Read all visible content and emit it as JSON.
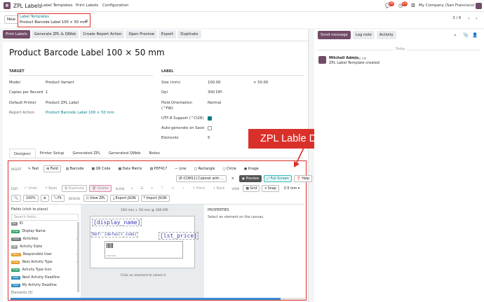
{
  "app": {
    "name": "ZPL Labels",
    "menu": [
      "Label Templates",
      "Print Labels",
      "Configuration"
    ],
    "msg_count": "26",
    "activity_count": "25",
    "company": "My Company (San Francisco)"
  },
  "breadcrumb": {
    "new": "New",
    "parent": "Label Templates",
    "current": "Product Barcode Label 100 × 50 mm"
  },
  "pager": "3 / 6",
  "actions": [
    "Print Labels",
    "Generate ZPL & QWeb",
    "Create Report Action",
    "Open Preview",
    "Export",
    "Duplicate"
  ],
  "form": {
    "title": "Product Barcode Label 100 × 50 mm",
    "target_header": "TARGET",
    "label_header": "LABEL",
    "target": [
      {
        "k": "Model",
        "v": "Product Variant"
      },
      {
        "k": "Copies per Record",
        "v": "1"
      },
      {
        "k": "Default Printer",
        "v": "Product ZPL Label"
      },
      {
        "k": "Report Action",
        "v": "Product Barcode Label 100 × 50 mm"
      }
    ],
    "label": [
      {
        "k": "Size (mm)",
        "v": "100.00",
        "v2": "× 50.00"
      },
      {
        "k": "Dpi",
        "v": "300 DPI"
      },
      {
        "k": "Field Orientation (^FW)",
        "v": "Normal"
      },
      {
        "k": "UTF-8 Support (^CI28)",
        "v": ""
      },
      {
        "k": "Auto-generate on Save",
        "v": ""
      },
      {
        "k": "Elements",
        "v": "5"
      }
    ]
  },
  "tabs": [
    "Designer",
    "Printer Setup",
    "Generated ZPL",
    "Generated QWeb",
    "Notes"
  ],
  "designer": {
    "insert_label": "INSERT",
    "insert": [
      "Text",
      "Field",
      "Barcode",
      "QR Code",
      "Data Matrix",
      "PDF417",
      "Line",
      "Rectangle",
      "Circle",
      "Image"
    ],
    "printer": "[E-COM11] Cabinet with ...",
    "x": "×",
    "preview": "Preview",
    "fullscreen": "Full Screen",
    "help": "Help",
    "edit_label": "EDIT",
    "edit": [
      "Undo",
      "Redo",
      "Duplicate",
      "Delete"
    ],
    "align_label": "ALIGN",
    "order": [
      "Front",
      "Back"
    ],
    "view_label": "VIEW",
    "view": [
      "Grid",
      "Snap"
    ],
    "snap_value": "0.5 mm",
    "zoom": [
      "100%"
    ],
    "fit": "Fit",
    "design_label": "DESIGN",
    "design": [
      "View ZPL",
      "Export JSON",
      "Import JSON"
    ],
    "fields_header": "Fields (click to place)",
    "search_placeholder": "Search fields...",
    "fields": [
      {
        "tag": "Int",
        "name": "ID",
        "c": "#888"
      },
      {
        "tag": "Char",
        "name": "Display Name",
        "c": "#35a66a"
      },
      {
        "tag": "One2",
        "name": "Activities",
        "c": "#777"
      },
      {
        "tag": "sel",
        "name": "Activity State",
        "c": "#999"
      },
      {
        "tag": "Many",
        "name": "Responsible User",
        "c": "#e59b2b"
      },
      {
        "tag": "Char",
        "name": "Next Activity Type",
        "c": "#e59b2b"
      },
      {
        "tag": "Char",
        "name": "Activity Type Icon",
        "c": "#35a66a"
      },
      {
        "tag": "Date",
        "name": "Next Activity Deadline",
        "c": "#2a8bc0"
      },
      {
        "tag": "Date",
        "name": "My Activity Deadline",
        "c": "#2a8bc0"
      },
      {
        "tag": "",
        "name": "Elements (5)",
        "c": "#fff"
      }
    ],
    "canvas_hdr": "100 mm × 50 mm @ 300 DPI",
    "canvas_text": [
      "[display_name]",
      "Ref: [default_code]",
      "[lst_price]"
    ],
    "barcode_lbl": "barcode",
    "canvas_hint": "Click an element to select it",
    "props_header": "PROPERTIES",
    "props_hint": "Select an element on the canvas."
  },
  "chatter": {
    "send": "Send message",
    "log": "Log note",
    "activity": "Activity",
    "today": "Today",
    "author": "Mitchell Admin",
    "time": "2:00 AM",
    "message": "ZPL Label Template created"
  },
  "annotation": "ZPL Lable Designer with advance tools"
}
